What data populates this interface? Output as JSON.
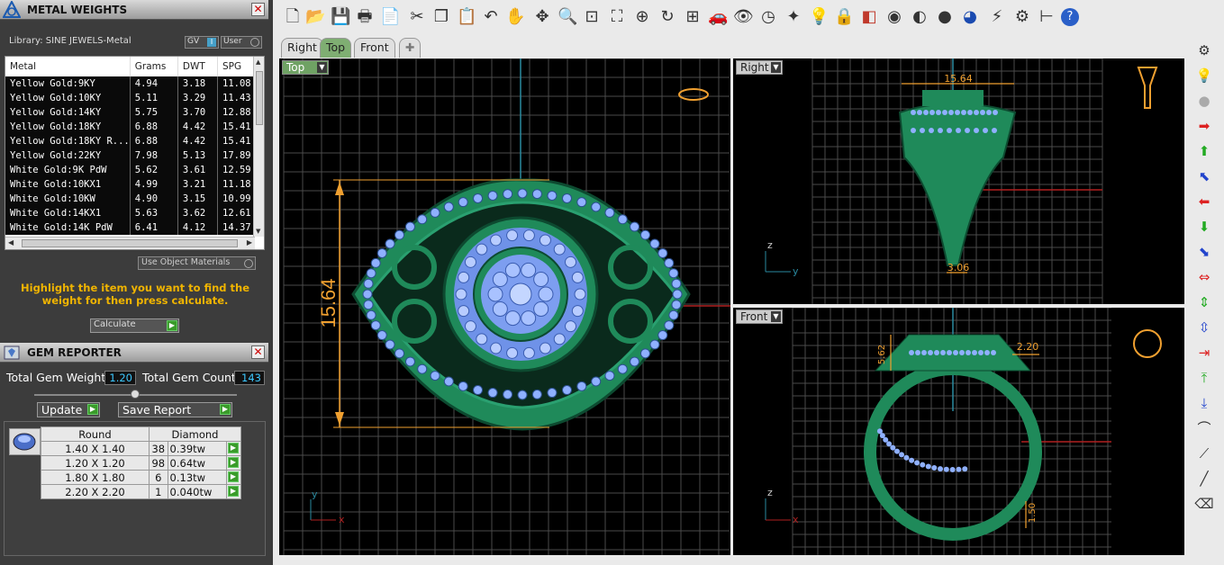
{
  "metal_panel": {
    "title": "METAL WEIGHTS",
    "library": "Library: SINE JEWELS-Metal",
    "toggle_gv": "GV",
    "toggle_gv_box": "I",
    "toggle_user": "User",
    "columns": [
      "Metal",
      "Grams",
      "DWT",
      "SPG"
    ],
    "rows": [
      [
        "Yellow Gold:9KY",
        "4.94",
        "3.18",
        "11.08"
      ],
      [
        "Yellow Gold:10KY",
        "5.11",
        "3.29",
        "11.43"
      ],
      [
        "Yellow Gold:14KY",
        "5.75",
        "3.70",
        "12.88"
      ],
      [
        "Yellow Gold:18KY",
        "6.88",
        "4.42",
        "15.41"
      ],
      [
        "Yellow Gold:18KY R...",
        "6.88",
        "4.42",
        "15.41"
      ],
      [
        "Yellow Gold:22KY",
        "7.98",
        "5.13",
        "17.89"
      ],
      [
        "White Gold:9K PdW",
        "5.62",
        "3.61",
        "12.59"
      ],
      [
        "White Gold:10KX1",
        "4.99",
        "3.21",
        "11.18"
      ],
      [
        "White Gold:10KW",
        "4.90",
        "3.15",
        "10.99"
      ],
      [
        "White Gold:14KX1",
        "5.63",
        "3.62",
        "12.61"
      ],
      [
        "White Gold:14K PdW",
        "6.41",
        "4.12",
        "14.37"
      ]
    ],
    "use_object_materials": "Use Object Materials",
    "hint": "Highlight the item you want to find the weight for then press calculate.",
    "calculate": "Calculate"
  },
  "gem_panel": {
    "title": "GEM REPORTER",
    "total_weight_label": "Total Gem Weight",
    "total_weight": "1.20",
    "total_count_label": "Total Gem Count",
    "total_count": "143",
    "update": "Update",
    "save_report": "Save Report",
    "columns": [
      "Round",
      "Diamond"
    ],
    "rows": [
      [
        "1.40 X 1.40",
        "38",
        "0.39tw"
      ],
      [
        "1.20 X 1.20",
        "98",
        "0.64tw"
      ],
      [
        "1.80 X 1.80",
        "6",
        "0.13tw"
      ],
      [
        "2.20 X 2.20",
        "1",
        "0.040tw"
      ]
    ]
  },
  "tabs": [
    "Right",
    "Top",
    "Front"
  ],
  "viewports": {
    "top": {
      "label": "Top",
      "dim_vertical": "15.64",
      "axis_y": "y",
      "axis_x": "x"
    },
    "right": {
      "label": "Right",
      "dim_top": "15.64",
      "dim_bottom": "3.06",
      "axis_z": "z",
      "axis_y": "y"
    },
    "front": {
      "label": "Front",
      "dim_left": "5.62",
      "dim_right": "2.20",
      "dim_bottom": "1.50",
      "axis_z": "z",
      "axis_x": "x"
    }
  },
  "colors": {
    "ring": "#1f8a5a",
    "gem": "#8fb0ff",
    "dim": "#f0a030",
    "grid": "#555555"
  }
}
